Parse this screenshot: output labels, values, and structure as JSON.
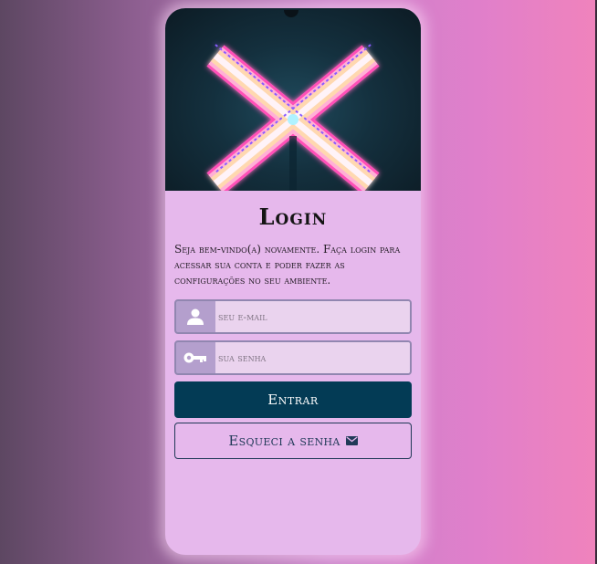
{
  "login": {
    "title": "Login",
    "description": "Seja bem-vindo(a) novamente. Faça login para acessar sua conta e poder fazer as configurações no seu ambiente.",
    "email": {
      "placeholder": "seu e-mail",
      "value": "",
      "icon": "user-icon"
    },
    "password": {
      "placeholder": "sua senha",
      "value": "",
      "icon": "key-icon"
    },
    "submit_label": "Entrar",
    "forgot_label": "Esqueci a senha",
    "forgot_icon": "envelope-icon"
  },
  "hero": {
    "image": "neon-x-sign"
  },
  "colors": {
    "card": "#e6b8ec",
    "primary_button": "#033b55",
    "input_icon_bg": "#b49fcd",
    "input_bg": "#ead3ee"
  }
}
